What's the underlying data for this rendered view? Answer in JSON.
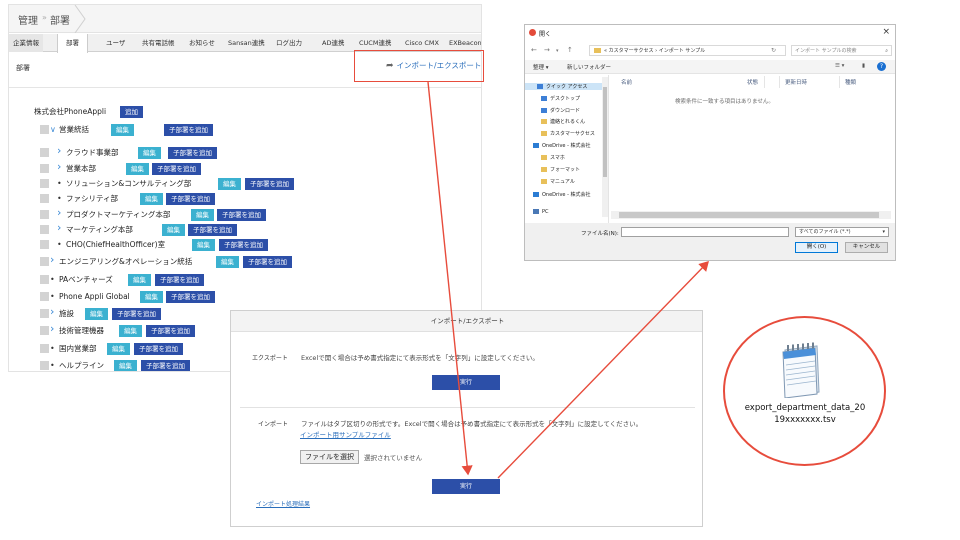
{
  "breadcrumb": {
    "root": "管理",
    "sep": "»",
    "current": "部署"
  },
  "tabs": [
    "企業情報",
    "部署",
    "ユーザ",
    "共有電話帳",
    "お知らせ",
    "Sansan連携",
    "ログ出力",
    "AD連携",
    "CUCM連携",
    "Cisco CMX",
    "EXBeacon"
  ],
  "section_title": "部署",
  "import_export_link": "インポート/エクスポート",
  "company": {
    "name": "株式会社PhoneAppli",
    "add_label": "追加"
  },
  "edit_label": "編集",
  "add_child_label": "子部署を追加",
  "departments": [
    {
      "name": "営業統括",
      "marker": "v"
    },
    {
      "name": "クラウド事業部",
      "marker": ">"
    },
    {
      "name": "営業本部",
      "marker": ">"
    },
    {
      "name": "ソリューション&コンサルティング部",
      "marker": "•"
    },
    {
      "name": "ファシリティ部",
      "marker": "•"
    },
    {
      "name": "プロダクトマーケティング本部",
      "marker": ">"
    },
    {
      "name": "マーケティング本部",
      "marker": ">"
    },
    {
      "name": "CHO(ChiefHealthOfficer)室",
      "marker": "•"
    },
    {
      "name": "エンジニアリング&オペレーション統括",
      "marker": ">"
    },
    {
      "name": "PAベンチャーズ",
      "marker": "•"
    },
    {
      "name": "Phone Appli Global",
      "marker": "•"
    },
    {
      "name": "施設",
      "marker": ">"
    },
    {
      "name": "技術管理機器",
      "marker": ">"
    },
    {
      "name": "国内営業部",
      "marker": "•"
    },
    {
      "name": "ヘルプライン",
      "marker": "•"
    }
  ],
  "dialog": {
    "title": "開く",
    "close": "×",
    "address": "« カスタマーサクセス › インポート サンプル",
    "search_placeholder": "インポート サンプルの検索",
    "toolbar": {
      "organize": "整理 ▾",
      "new_folder": "新しいフォルダー"
    },
    "nav_items": [
      "クイック アクセス",
      "デスクトップ",
      "ダウンロード",
      "連絡とれるくん",
      "カスタマーサクセス",
      "OneDrive - 株式会社",
      "スマホ",
      "フォーマット",
      "マニュアル",
      "OneDrive - 株式会社",
      "PC"
    ],
    "columns": [
      "名前",
      "状態",
      "更新日時",
      "種類"
    ],
    "empty_message": "検索条件に一致する項目はありません。",
    "file_name_label": "ファイル名(N):",
    "file_type": "すべてのファイル (*.*)",
    "open_button": "開く(O)",
    "cancel_button": "キャンセル"
  },
  "modal": {
    "title": "インポート/エクスポート",
    "export_label": "エクスポート",
    "export_text": "Excelで開く場合は予め書式指定にて表示形式を「文字列」に設定してください。",
    "run_label": "実行",
    "import_label": "インポート",
    "import_text": "ファイルはタブ区切りの形式です。Excelで開く場合は予め書式指定にて表示形式を「文字列」に設定してください。",
    "sample_link": "インポート用サンプルファイル",
    "choose_file": "ファイルを選択",
    "no_file": "選択されていません",
    "result_link": "インポート処理結果"
  },
  "export_file": {
    "line1": "export_department_data_20",
    "line2": "19xxxxxxx.tsv"
  },
  "colors": {
    "accent_red": "#e74c3c",
    "edit_button": "#3bb1d0",
    "add_button": "#2c4fa8",
    "link": "#2a6ebb"
  }
}
